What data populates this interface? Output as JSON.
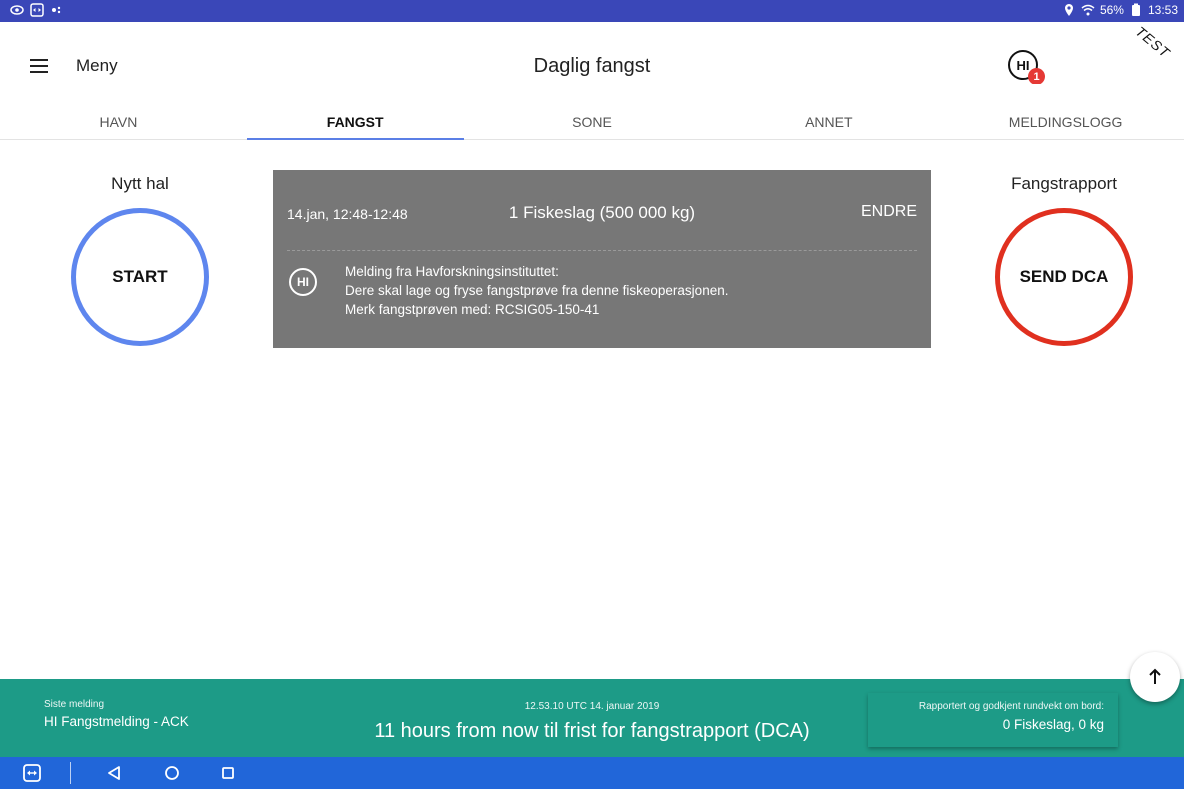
{
  "status_bar": {
    "battery": "56%",
    "time": "13:53"
  },
  "app_bar": {
    "menu_label": "Meny",
    "title": "Daglig fangst",
    "hi_label": "HI",
    "hi_count": "1",
    "test_label": "TEST"
  },
  "tabs": [
    {
      "label": "HAVN"
    },
    {
      "label": "FANGST"
    },
    {
      "label": "SONE"
    },
    {
      "label": "ANNET"
    },
    {
      "label": "MELDINGSLOGG"
    }
  ],
  "left": {
    "heading": "Nytt hal",
    "button": "START"
  },
  "right": {
    "heading": "Fangstrapport",
    "button": "SEND DCA"
  },
  "card": {
    "time_range": "14.jan, 12:48-12:48",
    "summary": "1 Fiskeslag (500 000 kg)",
    "edit_label": "ENDRE",
    "hi_label": "HI",
    "message_lines": [
      "Melding fra Havforskningsinstituttet:",
      "Dere skal lage og fryse fangstprøve fra denne fiskeoperasjonen.",
      "Merk fangstprøven med: RCSIG05-150-41"
    ]
  },
  "footer": {
    "last_label": "Siste melding",
    "last_value": "HI Fangstmelding - ACK",
    "timestamp": "12.53.10 UTC 14. januar 2019",
    "deadline": "11 hours from now til frist for fangstrapport (DCA)",
    "reported_label": "Rapportert og godkjent rundvekt om bord:",
    "reported_value": "0 Fiskeslag, 0 kg"
  },
  "icons": {
    "menu": "hamburger-icon",
    "fab": "arrow-up-icon",
    "nav": [
      "teamviewer-icon",
      "back-icon",
      "home-icon",
      "recents-icon"
    ]
  },
  "colors": {
    "status_bar": "#3a47b8",
    "start_ring": "#5e86ee",
    "send_ring": "#e0301f",
    "card": "#777777",
    "footer": "#1d9b87",
    "nav_bar": "#2166d9",
    "tab_indicator": "#5b7fe6",
    "badge": "#e53935"
  }
}
